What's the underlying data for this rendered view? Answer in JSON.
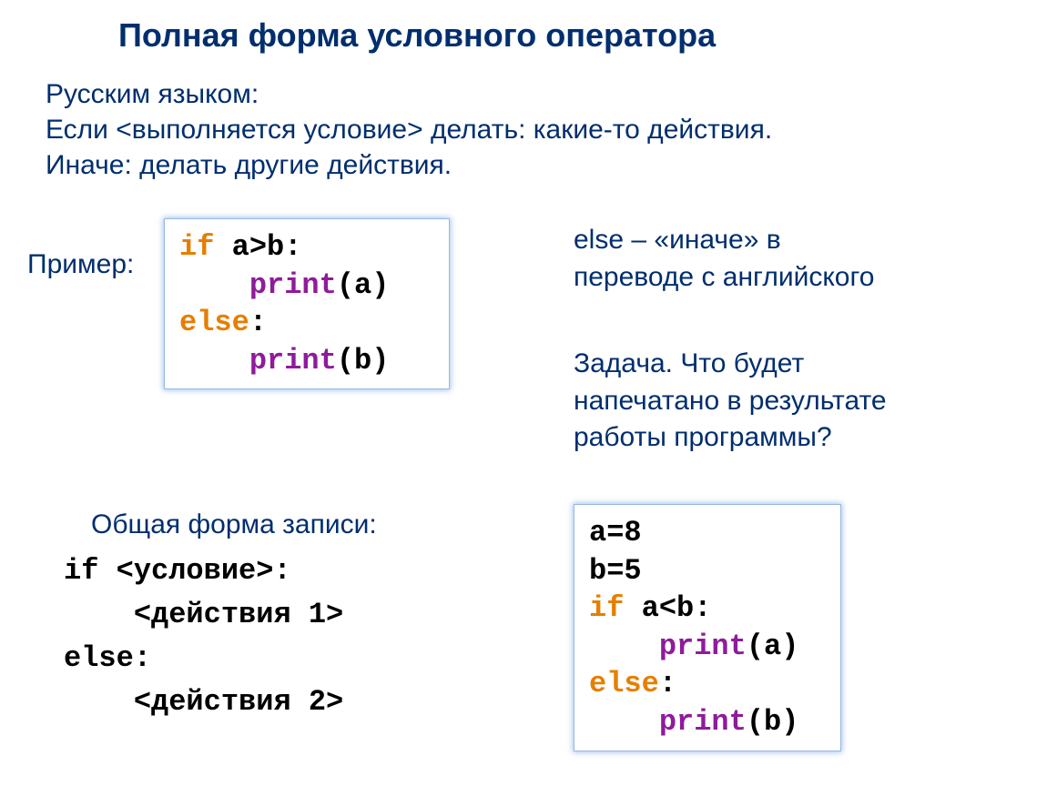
{
  "title": "Полная форма условного оператора",
  "intro_line1": "Русским языком:",
  "intro_line2": "Если <выполняется условие> делать: какие-то действия.",
  "intro_line3": "Иначе: делать другие действия.",
  "example_label": "Пример:",
  "code1": {
    "l1_kw": "if",
    "l1_rest": " a>b:",
    "l2_indent": "    ",
    "l2_fn": "print",
    "l2_rest": "(a)",
    "l3_kw": "else",
    "l3_rest": ":",
    "l4_indent": "    ",
    "l4_fn": "print",
    "l4_rest": "(b)"
  },
  "right1_line1": "else – «иначе» в",
  "right1_line2": "переводе с английского",
  "right2_line1": "Задача. Что будет",
  "right2_line2": "напечатано в результате",
  "right2_line3": "работы программы?",
  "general_label": "Общая форма записи:",
  "general_code": {
    "l1": "if <условие>:",
    "l2": "    <действия 1>",
    "l3": "else:",
    "l4": "    <действия 2>"
  },
  "code2": {
    "l1": "a=8",
    "l2": "b=5",
    "l3_kw": "if",
    "l3_rest": " a<b:",
    "l4_indent": "    ",
    "l4_fn": "print",
    "l4_rest": "(a)",
    "l5_kw": "else",
    "l5_rest": ":",
    "l6_indent": "    ",
    "l6_fn": "print",
    "l6_rest": "(b)"
  }
}
